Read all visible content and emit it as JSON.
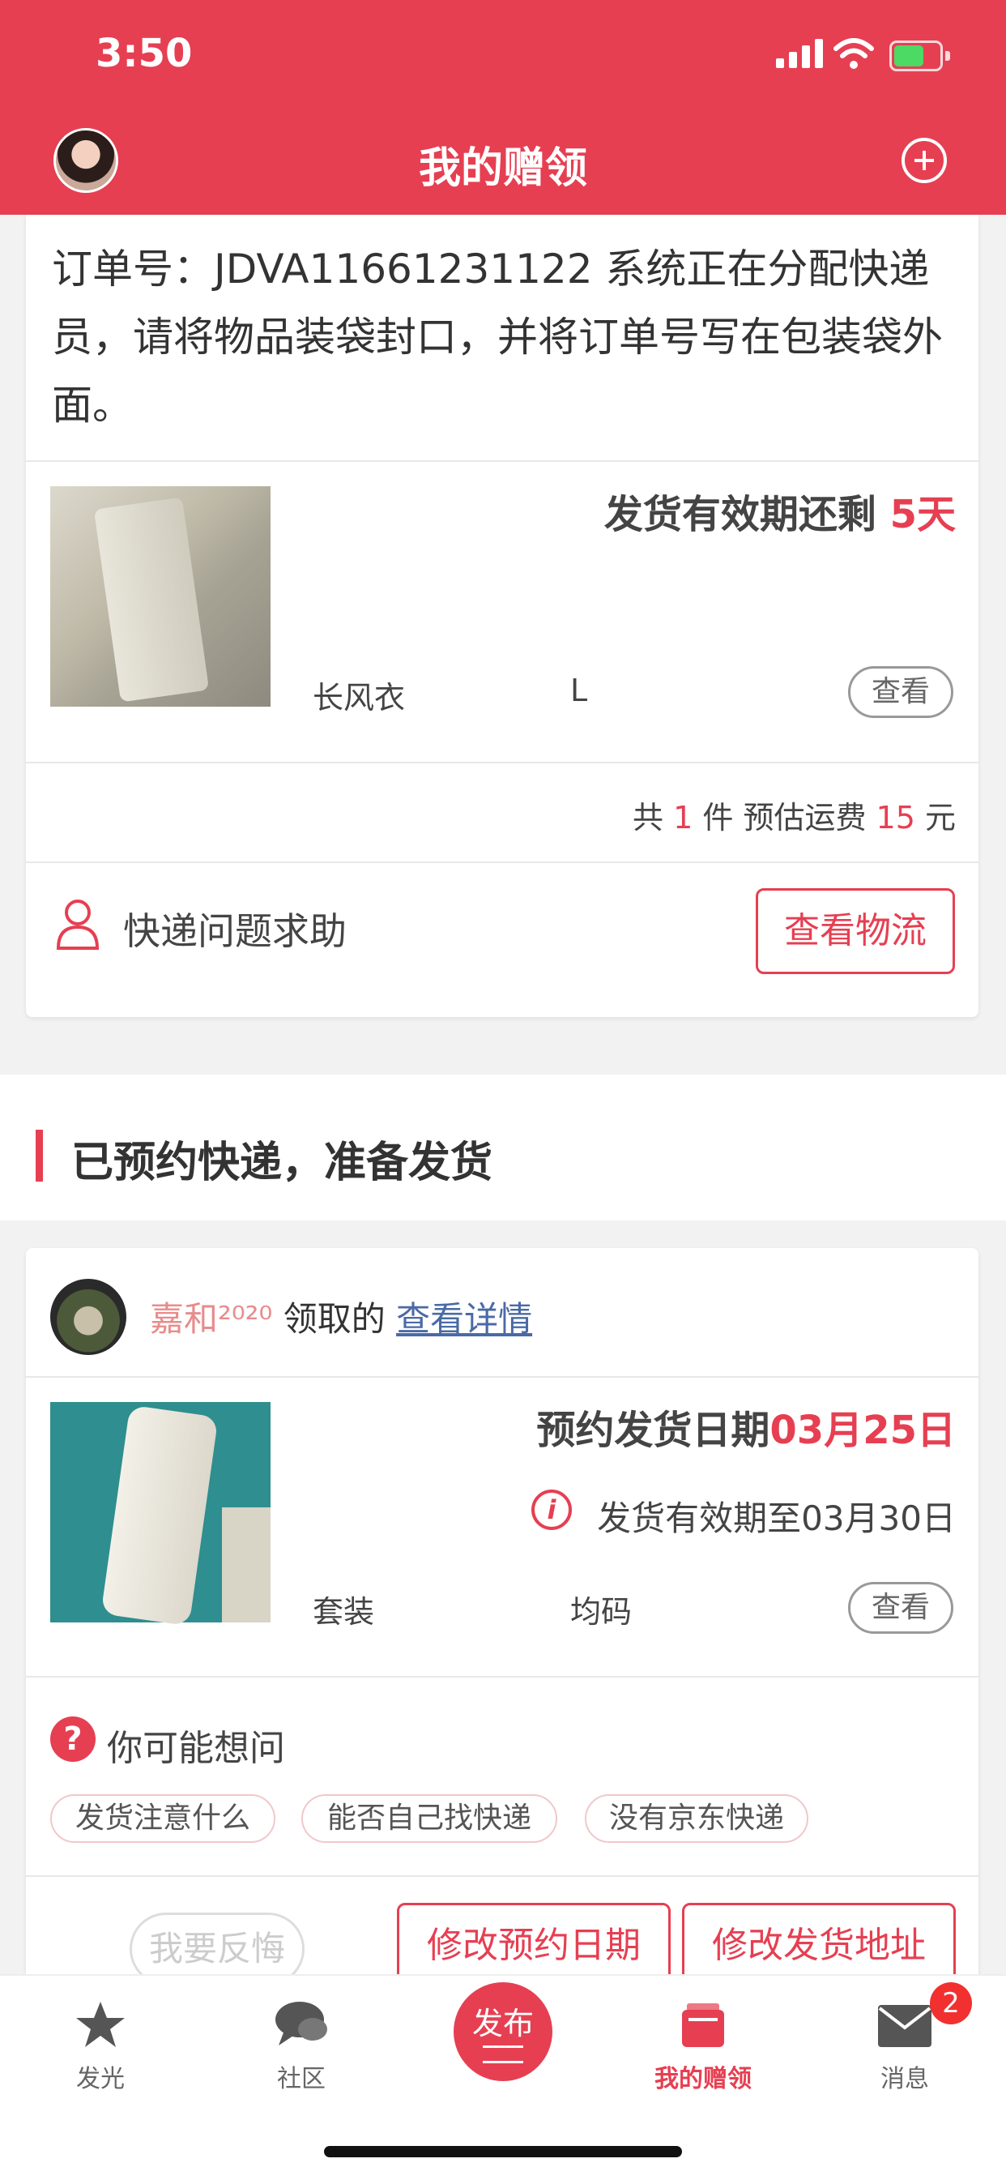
{
  "status_bar": {
    "time": "3:50"
  },
  "header": {
    "title": "我的赠领"
  },
  "order_card": {
    "order_text": "订单号：JDVA11661231122 系统正在分配快递员，请将物品装袋封口，并将订单号写在包装袋外面。",
    "deadline_prefix": "发货有效期还剩 ",
    "deadline_value": "5天",
    "item_name": "长风衣",
    "item_size": "L",
    "view_label": "查看",
    "total_prefix": "共 ",
    "total_count": "1",
    "total_mid": " 件 预估运费 ",
    "total_fee": "15",
    "total_suffix": " 元",
    "help_label": "快递问题求助",
    "logistics_label": "查看物流"
  },
  "section": {
    "title": "已预约快递，准备发货"
  },
  "reserved_card": {
    "claimer_name": "嘉和²⁰²⁰",
    "claimer_mid": " 领取的 ",
    "details_link": "查看详情",
    "ship_date_label": "预约发货日期",
    "ship_date_value": "03月25日",
    "valid_until": "发货有效期至03月30日",
    "item_name": "套装",
    "item_size": "均码",
    "view_label": "查看",
    "faq_title": "你可能想问",
    "faq_chips": [
      "发货注意什么",
      "能否自己找快递",
      "没有京东快递"
    ],
    "regret_label": "我要反悔",
    "change_date_label": "修改预约日期",
    "change_address_label": "修改发货地址"
  },
  "tabbar": {
    "tabs": [
      {
        "label": "发光",
        "icon": "star-icon"
      },
      {
        "label": "社区",
        "icon": "chat-icon"
      },
      {
        "label": "发布",
        "icon": "publish-icon"
      },
      {
        "label": "我的赠领",
        "icon": "gift-box-icon",
        "active": true
      },
      {
        "label": "消息",
        "icon": "mail-icon",
        "badge": "2"
      }
    ]
  },
  "colors": {
    "accent": "#e63f52",
    "link": "#4a6aa5"
  }
}
